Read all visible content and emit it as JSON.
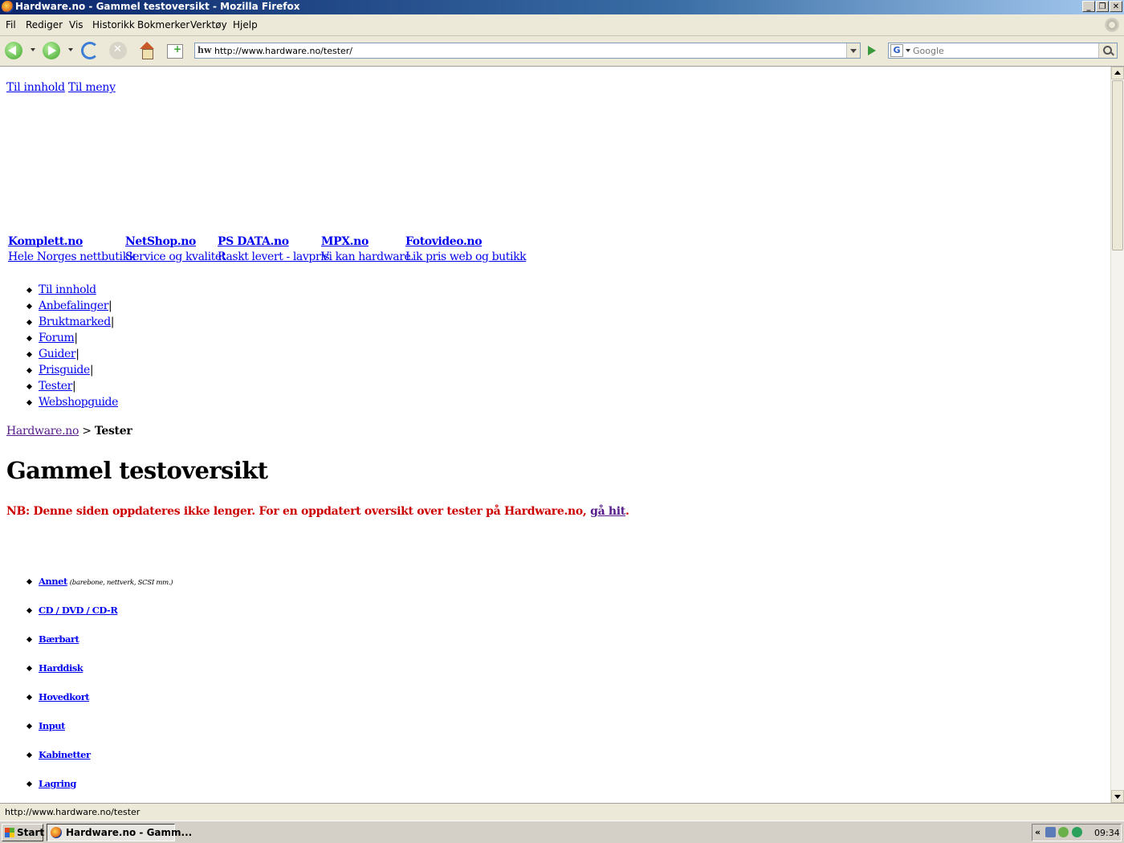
{
  "window": {
    "title": "Hardware.no - Gammel testoversikt - Mozilla Firefox",
    "minimize": "_",
    "restore": "❐",
    "close": "✕"
  },
  "menubar": {
    "items": [
      "Fil",
      "Rediger",
      "Vis",
      "Historikk",
      "Bokmerker",
      "Verktøy",
      "Hjelp"
    ]
  },
  "navbar": {
    "url": "http://www.hardware.no/tester/",
    "favicon_text": "hw",
    "search_placeholder": "Google",
    "search_engine_letter": "G"
  },
  "page": {
    "skip_links": [
      "Til innhold",
      "Til meny"
    ],
    "partners": [
      {
        "name": "Komplett.no",
        "tagline": "Hele Norges nettbutikk"
      },
      {
        "name": "NetShop.no",
        "tagline": "Service og kvalitet"
      },
      {
        "name": "PS DATA.no",
        "tagline": "Raskt levert - lavpris"
      },
      {
        "name": "MPX.no",
        "tagline": "Vi kan hardware"
      },
      {
        "name": "Fotovideo.no",
        "tagline": "Lik pris web og butikk"
      }
    ],
    "menu": [
      "Til innhold",
      "Anbefalinger",
      "Bruktmarked",
      "Forum",
      "Guider",
      "Prisguide",
      "Tester",
      "Webshopguide"
    ],
    "menu_separator": "|",
    "breadcrumb": {
      "home": "Hardware.no",
      "separator": " > ",
      "current": "Tester"
    },
    "title": "Gammel testoversikt",
    "notice": {
      "text": "NB: Denne siden oppdateres ikke lenger. For en oppdatert oversikt over tester på Hardware.no, ",
      "link": "gå hit",
      "end": "."
    },
    "categories": [
      {
        "label": "Annet",
        "note": "(barebone, nettverk, SCSI mm.)"
      },
      {
        "label": "CD / DVD / CD-R"
      },
      {
        "label": "Bærbart"
      },
      {
        "label": "Harddisk"
      },
      {
        "label": "Hovedkort"
      },
      {
        "label": "Input"
      },
      {
        "label": "Kabinetter"
      },
      {
        "label": "Lagring"
      }
    ]
  },
  "statusbar": {
    "text": "http://www.hardware.no/tester"
  },
  "taskbar": {
    "start": "Start",
    "task": "Hardware.no - Gamm...",
    "tray_chevron": "«",
    "clock": "09:34"
  },
  "colors": {
    "link": "#0000ee",
    "visited": "#551a8b",
    "notice": "#cc0000",
    "titlebar": "#0a246a"
  }
}
